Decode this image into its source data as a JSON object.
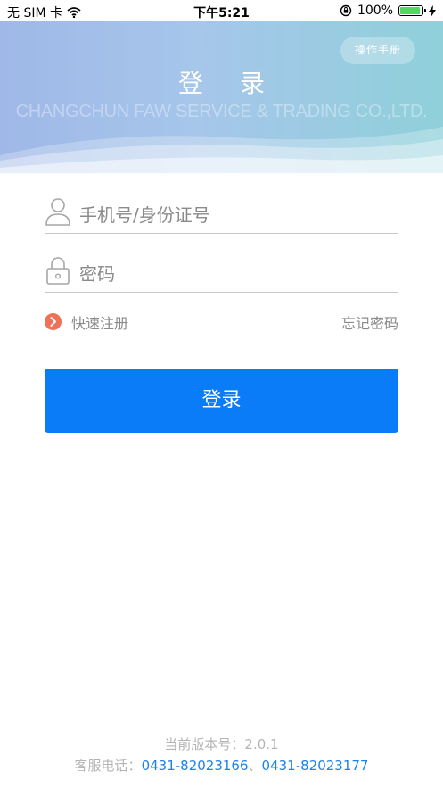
{
  "status_bar": {
    "carrier": "无 SIM 卡",
    "time": "下午5:21",
    "battery_percent": "100%",
    "battery_level": 1.0
  },
  "header": {
    "manual_button": "操作手册",
    "title": "登 录",
    "company": "CHANGCHUN FAW SERVICE & TRADING CO.,LTD."
  },
  "form": {
    "username_placeholder": "手机号/身份证号",
    "password_placeholder": "密码",
    "register_link": "快速注册",
    "forgot_link": "忘记密码",
    "login_button": "登录"
  },
  "footer": {
    "version": "当前版本号：2.0.1",
    "service_label": "客服电话：",
    "phone_1": "0431-82023166",
    "separator": "、",
    "phone_2": "0431-82023177"
  },
  "colors": {
    "primary": "#0a7cf7",
    "register_icon": "#ee7158",
    "link": "#1a82ee"
  },
  "icons": [
    "wifi-icon",
    "orientation-lock-icon",
    "battery-icon",
    "charging-icon",
    "user-icon",
    "lock-icon",
    "chevron-right-icon"
  ]
}
